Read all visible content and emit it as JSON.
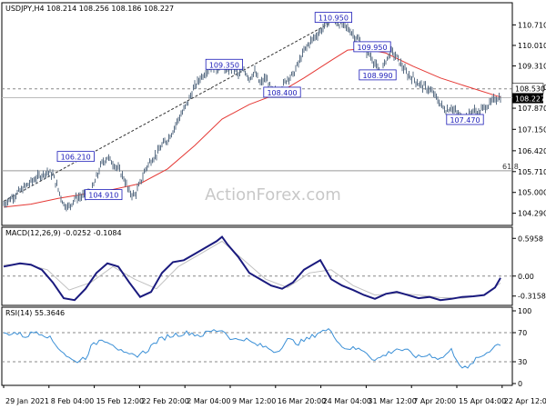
{
  "chart_data": [
    {
      "id": "price",
      "type": "candlestick",
      "title": "USDJPY,H4  108.214 108.256 108.186 108.227",
      "watermark": "ActionForex.com",
      "y_ticks": [
        104.29,
        105.0,
        105.71,
        106.42,
        107.15,
        107.87,
        108.58,
        109.31,
        110.01,
        110.71
      ],
      "ylim": [
        104.0,
        111.0
      ],
      "current_price_label": "108.227",
      "level_label": "108.530",
      "fib_label": "61.8",
      "fib_level": 105.74,
      "annotations": [
        {
          "text": "110.950",
          "x": 60.4,
          "y": 110.95
        },
        {
          "text": "109.350",
          "x": 40.4,
          "y": 109.35
        },
        {
          "text": "108.400",
          "x": 51.0,
          "y": 108.4
        },
        {
          "text": "106.210",
          "x": 13.2,
          "y": 106.21
        },
        {
          "text": "104.910",
          "x": 18.3,
          "y": 104.91
        },
        {
          "text": "108.990",
          "x": 68.5,
          "y": 108.99
        },
        {
          "text": "109.950",
          "x": 67.5,
          "y": 109.95
        },
        {
          "text": "107.470",
          "x": 84.5,
          "y": 107.47
        }
      ],
      "price_path": [
        [
          0,
          104.6
        ],
        [
          2,
          104.9
        ],
        [
          4,
          105.2
        ],
        [
          6,
          105.5
        ],
        [
          8,
          105.7
        ],
        [
          9,
          105.6
        ],
        [
          10,
          105.1
        ],
        [
          11,
          104.6
        ],
        [
          12,
          104.5
        ],
        [
          13,
          104.8
        ],
        [
          15,
          104.9
        ],
        [
          16,
          105.0
        ],
        [
          17,
          105.5
        ],
        [
          18,
          106.0
        ],
        [
          19,
          106.2
        ],
        [
          20,
          106.0
        ],
        [
          21,
          105.8
        ],
        [
          22,
          105.5
        ],
        [
          23,
          105.0
        ],
        [
          24,
          104.9
        ],
        [
          25,
          105.3
        ],
        [
          26,
          105.8
        ],
        [
          27,
          106.1
        ],
        [
          28,
          106.3
        ],
        [
          29,
          106.6
        ],
        [
          30,
          106.8
        ],
        [
          31,
          107.1
        ],
        [
          32,
          107.5
        ],
        [
          33,
          107.8
        ],
        [
          34,
          108.2
        ],
        [
          35,
          108.6
        ],
        [
          36,
          108.9
        ],
        [
          37,
          109.1
        ],
        [
          38,
          109.3
        ],
        [
          39,
          109.2
        ],
        [
          40,
          109.35
        ],
        [
          41,
          109.1
        ],
        [
          42,
          109.3
        ],
        [
          43,
          109.0
        ],
        [
          44,
          109.2
        ],
        [
          45,
          108.9
        ],
        [
          46,
          109.1
        ],
        [
          47,
          108.7
        ],
        [
          48,
          108.9
        ],
        [
          49,
          108.5
        ],
        [
          50,
          108.4
        ],
        [
          51,
          108.6
        ],
        [
          52,
          108.9
        ],
        [
          53,
          109.0
        ],
        [
          54,
          109.4
        ],
        [
          55,
          109.8
        ],
        [
          56,
          110.1
        ],
        [
          57,
          110.3
        ],
        [
          58,
          110.5
        ],
        [
          59,
          110.7
        ],
        [
          60,
          110.95
        ],
        [
          61,
          110.8
        ],
        [
          62,
          110.7
        ],
        [
          63,
          110.6
        ],
        [
          64,
          110.4
        ],
        [
          65,
          110.2
        ],
        [
          66,
          109.9
        ],
        [
          67,
          109.7
        ],
        [
          68,
          109.4
        ],
        [
          69,
          109.0
        ],
        [
          70,
          109.5
        ],
        [
          71,
          109.8
        ],
        [
          72,
          109.6
        ],
        [
          73,
          109.3
        ],
        [
          74,
          109.0
        ],
        [
          75,
          108.9
        ],
        [
          76,
          108.7
        ],
        [
          77,
          108.6
        ],
        [
          78,
          108.5
        ],
        [
          79,
          108.3
        ],
        [
          80,
          108.0
        ],
        [
          81,
          107.8
        ],
        [
          82,
          107.9
        ],
        [
          83,
          107.7
        ],
        [
          84,
          107.5
        ],
        [
          85,
          107.6
        ],
        [
          86,
          107.8
        ],
        [
          87,
          107.7
        ],
        [
          88,
          107.9
        ],
        [
          89,
          108.0
        ],
        [
          90,
          108.2
        ],
        [
          91,
          108.23
        ]
      ],
      "ma_path": [
        [
          0,
          104.5
        ],
        [
          5,
          104.6
        ],
        [
          10,
          104.8
        ],
        [
          15,
          104.95
        ],
        [
          20,
          105.1
        ],
        [
          25,
          105.3
        ],
        [
          30,
          105.8
        ],
        [
          35,
          106.6
        ],
        [
          40,
          107.5
        ],
        [
          45,
          108.0
        ],
        [
          50,
          108.35
        ],
        [
          55,
          108.9
        ],
        [
          60,
          109.5
        ],
        [
          63,
          109.85
        ],
        [
          66,
          109.9
        ],
        [
          70,
          109.75
        ],
        [
          75,
          109.3
        ],
        [
          80,
          108.9
        ],
        [
          85,
          108.6
        ],
        [
          91,
          108.25
        ]
      ],
      "trendline": [
        [
          0,
          104.7
        ],
        [
          62,
          111.0
        ]
      ]
    },
    {
      "id": "macd",
      "type": "line",
      "title": "MACD(12,26,9) -0.0252 -0.1084",
      "y_ticks": [
        0.5958,
        0.0,
        -0.3158
      ],
      "ylim": [
        -0.42,
        0.7
      ],
      "macd_path": [
        [
          0,
          0.15
        ],
        [
          3,
          0.2
        ],
        [
          5,
          0.18
        ],
        [
          7,
          0.1
        ],
        [
          9,
          -0.1
        ],
        [
          11,
          -0.35
        ],
        [
          13,
          -0.38
        ],
        [
          15,
          -0.2
        ],
        [
          17,
          0.05
        ],
        [
          19,
          0.2
        ],
        [
          21,
          0.15
        ],
        [
          23,
          -0.1
        ],
        [
          25,
          -0.33
        ],
        [
          27,
          -0.25
        ],
        [
          29,
          0.05
        ],
        [
          31,
          0.22
        ],
        [
          33,
          0.25
        ],
        [
          35,
          0.35
        ],
        [
          37,
          0.45
        ],
        [
          39,
          0.55
        ],
        [
          40,
          0.62
        ],
        [
          41,
          0.5
        ],
        [
          43,
          0.3
        ],
        [
          45,
          0.05
        ],
        [
          47,
          -0.05
        ],
        [
          49,
          -0.15
        ],
        [
          51,
          -0.2
        ],
        [
          53,
          -0.1
        ],
        [
          55,
          0.1
        ],
        [
          57,
          0.2
        ],
        [
          58,
          0.25
        ],
        [
          60,
          -0.05
        ],
        [
          62,
          -0.15
        ],
        [
          64,
          -0.22
        ],
        [
          66,
          -0.3
        ],
        [
          68,
          -0.36
        ],
        [
          70,
          -0.28
        ],
        [
          72,
          -0.25
        ],
        [
          74,
          -0.3
        ],
        [
          76,
          -0.35
        ],
        [
          78,
          -0.33
        ],
        [
          80,
          -0.38
        ],
        [
          82,
          -0.36
        ],
        [
          84,
          -0.33
        ],
        [
          86,
          -0.32
        ],
        [
          88,
          -0.3
        ],
        [
          90,
          -0.18
        ],
        [
          91,
          -0.03
        ]
      ],
      "signal_path": [
        [
          0,
          0.18
        ],
        [
          4,
          0.19
        ],
        [
          8,
          0.1
        ],
        [
          12,
          -0.22
        ],
        [
          16,
          -0.1
        ],
        [
          20,
          0.15
        ],
        [
          24,
          -0.05
        ],
        [
          28,
          -0.2
        ],
        [
          32,
          0.15
        ],
        [
          36,
          0.35
        ],
        [
          40,
          0.55
        ],
        [
          44,
          0.25
        ],
        [
          48,
          -0.05
        ],
        [
          52,
          -0.18
        ],
        [
          56,
          0.05
        ],
        [
          60,
          0.1
        ],
        [
          64,
          -0.15
        ],
        [
          68,
          -0.3
        ],
        [
          72,
          -0.27
        ],
        [
          76,
          -0.3
        ],
        [
          80,
          -0.34
        ],
        [
          84,
          -0.35
        ],
        [
          88,
          -0.3
        ],
        [
          91,
          -0.11
        ]
      ]
    },
    {
      "id": "rsi",
      "type": "line",
      "title": "RSI(14) 55.3646",
      "y_ticks": [
        100,
        70,
        30,
        0
      ],
      "ylim": [
        0,
        100
      ],
      "rsi_path": [
        [
          0,
          68
        ],
        [
          2,
          70
        ],
        [
          4,
          65
        ],
        [
          6,
          72
        ],
        [
          8,
          66
        ],
        [
          10,
          50
        ],
        [
          12,
          35
        ],
        [
          13,
          30
        ],
        [
          15,
          36
        ],
        [
          16,
          50
        ],
        [
          18,
          62
        ],
        [
          20,
          55
        ],
        [
          22,
          40
        ],
        [
          24,
          38
        ],
        [
          26,
          44
        ],
        [
          28,
          58
        ],
        [
          30,
          65
        ],
        [
          32,
          68
        ],
        [
          34,
          70
        ],
        [
          36,
          66
        ],
        [
          38,
          72
        ],
        [
          40,
          74
        ],
        [
          42,
          60
        ],
        [
          44,
          62
        ],
        [
          46,
          54
        ],
        [
          48,
          50
        ],
        [
          50,
          44
        ],
        [
          52,
          60
        ],
        [
          54,
          56
        ],
        [
          56,
          62
        ],
        [
          58,
          72
        ],
        [
          60,
          73
        ],
        [
          62,
          50
        ],
        [
          64,
          48
        ],
        [
          66,
          46
        ],
        [
          68,
          32
        ],
        [
          70,
          40
        ],
        [
          72,
          48
        ],
        [
          74,
          44
        ],
        [
          76,
          36
        ],
        [
          78,
          40
        ],
        [
          80,
          34
        ],
        [
          82,
          46
        ],
        [
          84,
          22
        ],
        [
          85,
          20
        ],
        [
          86,
          30
        ],
        [
          88,
          40
        ],
        [
          90,
          52
        ],
        [
          91,
          55
        ]
      ]
    }
  ],
  "x_axis_labels": [
    "29 Jan 2021",
    "8 Feb 04:00",
    "15 Feb 12:00",
    "22 Feb 20:00",
    "2 Mar 04:00",
    "9 Mar 12:00",
    "16 Mar 20:00",
    "24 Mar 04:00",
    "31 Mar 12:00",
    "7 Apr 20:00",
    "15 Apr 04:00",
    "22 Apr 12:00"
  ],
  "x_axis_positions": [
    0,
    8.3,
    16.6,
    24.9,
    33.2,
    41.5,
    49.8,
    58.1,
    66.4,
    74.7,
    83.0,
    91.3
  ],
  "colors": {
    "price": "#5b6f85",
    "ma": "#e53935",
    "trend": "#333333",
    "macd": "#1a1a7e",
    "signal": "#c0c0c0",
    "rsi": "#3a8fd6",
    "grid_dash": "#888888",
    "annotation_border": "#1a1ab8",
    "label_bg": "#ffffff",
    "current_label_bg": "#000000"
  }
}
